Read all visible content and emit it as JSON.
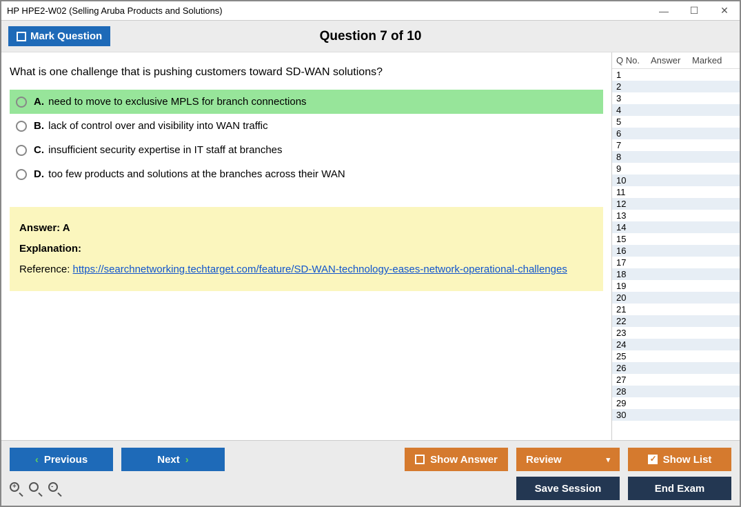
{
  "window": {
    "title": "HP HPE2-W02 (Selling Aruba Products and Solutions)"
  },
  "header": {
    "mark_label": "Mark Question",
    "question_title": "Question 7 of 10"
  },
  "question": {
    "text": "What is one challenge that is pushing customers toward SD-WAN solutions?",
    "options": [
      {
        "letter": "A.",
        "text": "need to move to exclusive MPLS for branch connections",
        "selected": true
      },
      {
        "letter": "B.",
        "text": "lack of control over and visibility into WAN traffic",
        "selected": false
      },
      {
        "letter": "C.",
        "text": "insufficient security expertise in IT staff at branches",
        "selected": false
      },
      {
        "letter": "D.",
        "text": "too few products and solutions at the branches across their WAN",
        "selected": false
      }
    ],
    "answer_label": "Answer: A",
    "explanation_label": "Explanation:",
    "reference_label": "Reference: ",
    "reference_link": "https://searchnetworking.techtarget.com/feature/SD-WAN-technology-eases-network-operational-challenges"
  },
  "sidebar": {
    "head_q": "Q No.",
    "head_a": "Answer",
    "head_m": "Marked",
    "rows": [
      {
        "no": "1"
      },
      {
        "no": "2"
      },
      {
        "no": "3"
      },
      {
        "no": "4"
      },
      {
        "no": "5"
      },
      {
        "no": "6"
      },
      {
        "no": "7"
      },
      {
        "no": "8"
      },
      {
        "no": "9"
      },
      {
        "no": "10"
      },
      {
        "no": "11"
      },
      {
        "no": "12"
      },
      {
        "no": "13"
      },
      {
        "no": "14"
      },
      {
        "no": "15"
      },
      {
        "no": "16"
      },
      {
        "no": "17"
      },
      {
        "no": "18"
      },
      {
        "no": "19"
      },
      {
        "no": "20"
      },
      {
        "no": "21"
      },
      {
        "no": "22"
      },
      {
        "no": "23"
      },
      {
        "no": "24"
      },
      {
        "no": "25"
      },
      {
        "no": "26"
      },
      {
        "no": "27"
      },
      {
        "no": "28"
      },
      {
        "no": "29"
      },
      {
        "no": "30"
      }
    ]
  },
  "footer": {
    "previous": "Previous",
    "next": "Next",
    "show_answer": "Show Answer",
    "review": "Review",
    "show_list": "Show List",
    "save_session": "Save Session",
    "end_exam": "End Exam"
  }
}
